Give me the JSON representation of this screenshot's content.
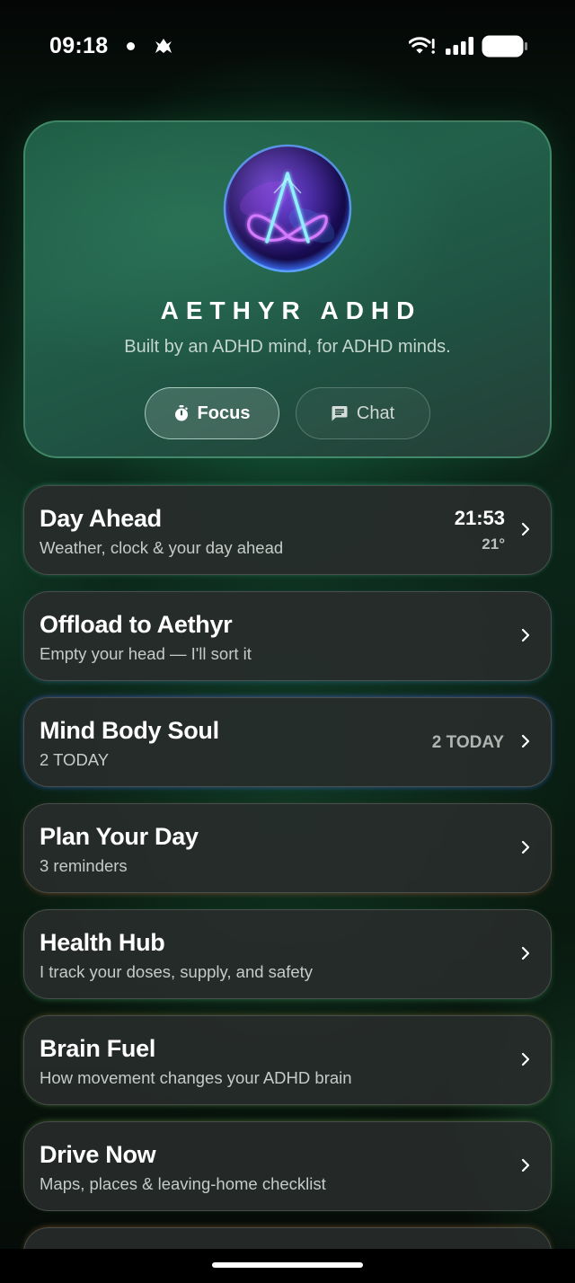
{
  "status_bar": {
    "time": "09:18",
    "icons": [
      "app-activity-icon",
      "wifi-alert-icon",
      "cellular-signal-icon",
      "battery-icon"
    ]
  },
  "hero": {
    "logo_icon": "aethyr-logo",
    "title": "AETHYR ADHD",
    "subtitle": "Built by an ADHD mind, for ADHD minds.",
    "buttons": [
      {
        "label": "Focus",
        "icon": "timer-icon",
        "selected": true
      },
      {
        "label": "Chat",
        "icon": "chat-bubble-icon",
        "selected": false
      }
    ]
  },
  "cards": [
    {
      "title": "Day Ahead",
      "subtitle": "Weather, clock & your day ahead",
      "time": "21:53",
      "temperature": "21°",
      "icon": "chevron-right-icon"
    },
    {
      "title": "Offload to Aethyr",
      "subtitle": "Empty your head — I'll sort it",
      "icon": "chevron-right-icon"
    },
    {
      "title": "Mind Body Soul",
      "subtitle": "2 TODAY",
      "badge": "2 TODAY",
      "icon": "chevron-right-icon"
    },
    {
      "title": "Plan Your Day",
      "subtitle": "3 reminders",
      "icon": "chevron-right-icon"
    },
    {
      "title": "Health Hub",
      "subtitle": "I track your doses, supply, and safety",
      "icon": "chevron-right-icon"
    },
    {
      "title": "Brain Fuel",
      "subtitle": "How movement changes your ADHD brain",
      "icon": "chevron-right-icon"
    },
    {
      "title": "Drive Now",
      "subtitle": "Maps, places & leaving-home checklist",
      "icon": "chevron-right-icon"
    }
  ],
  "colors": {
    "background": "#0a2016",
    "hero_green": "#1d5a43",
    "card_background": "#282c2b",
    "text_primary": "#ffffff",
    "text_secondary": "#c4ccc8"
  }
}
